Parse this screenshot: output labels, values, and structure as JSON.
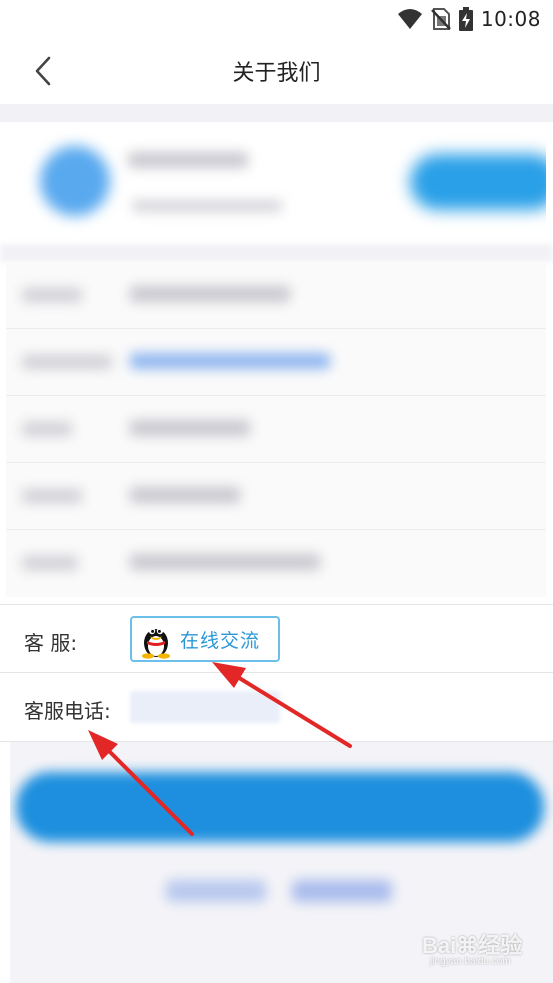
{
  "status_bar": {
    "time": "10:08",
    "icons": [
      "wifi-icon",
      "no-sim-icon",
      "battery-charging-icon"
    ]
  },
  "header": {
    "back_icon": "chevron-left-icon",
    "title": "关于我们"
  },
  "customer_service": {
    "service_label": "客 服:",
    "online_chat_label": "在线交流",
    "online_chat_icon": "qq-penguin-icon",
    "phone_label": "客服电话:"
  },
  "watermark": {
    "text": "Bai⌘经验",
    "sub": "jingyan.baidu.com"
  },
  "colors": {
    "accent_blue": "#2a97d6",
    "annotation_red": "#e32626",
    "blur_button_blue": "#1d8fde"
  }
}
